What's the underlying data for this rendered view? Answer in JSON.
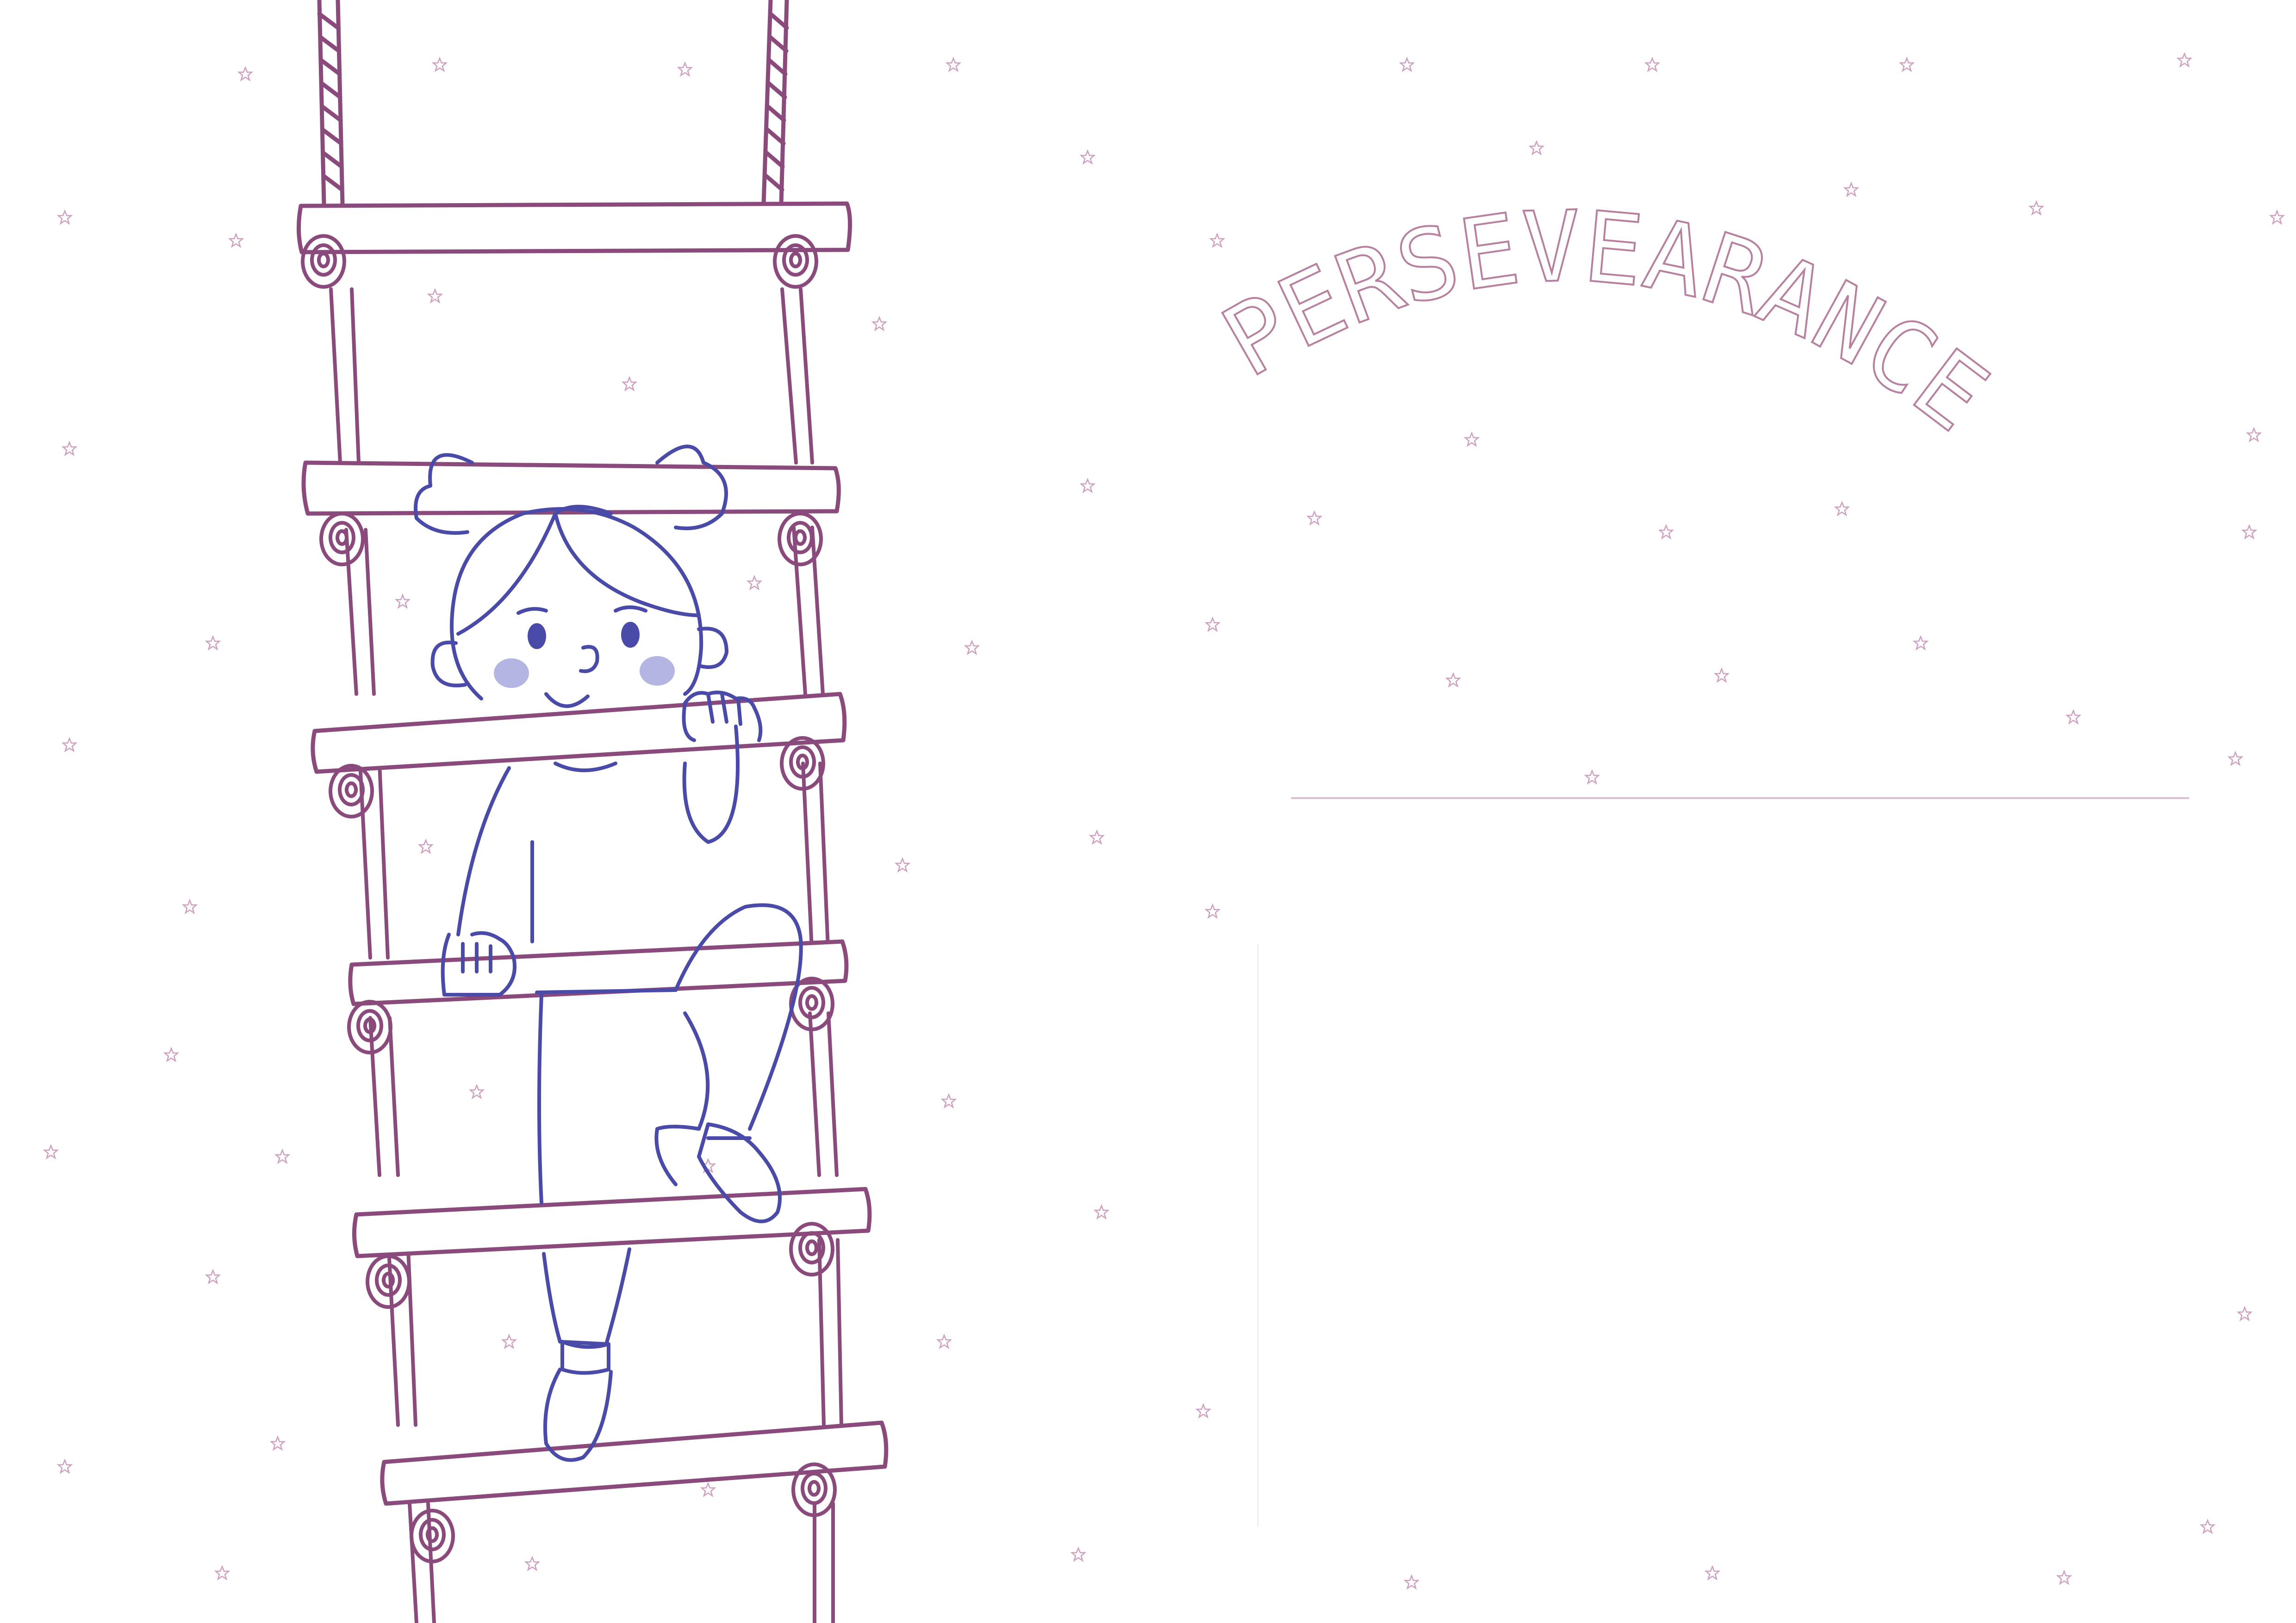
{
  "page": {
    "title": "PERSEVEARANCE",
    "background": "#ffffff"
  },
  "colors": {
    "ladder": "#8a4a7c",
    "ladder_light": "#a3709a",
    "child": "#4a4aa8",
    "cheek": "#8f8fd6",
    "stars": "#cf9fbf",
    "title": "#b8809f",
    "guide_line": "#d9bfd0"
  },
  "icons": {
    "star": "star-icon",
    "ladder": "rope-ladder-illustration",
    "child": "climbing-child-illustration"
  }
}
